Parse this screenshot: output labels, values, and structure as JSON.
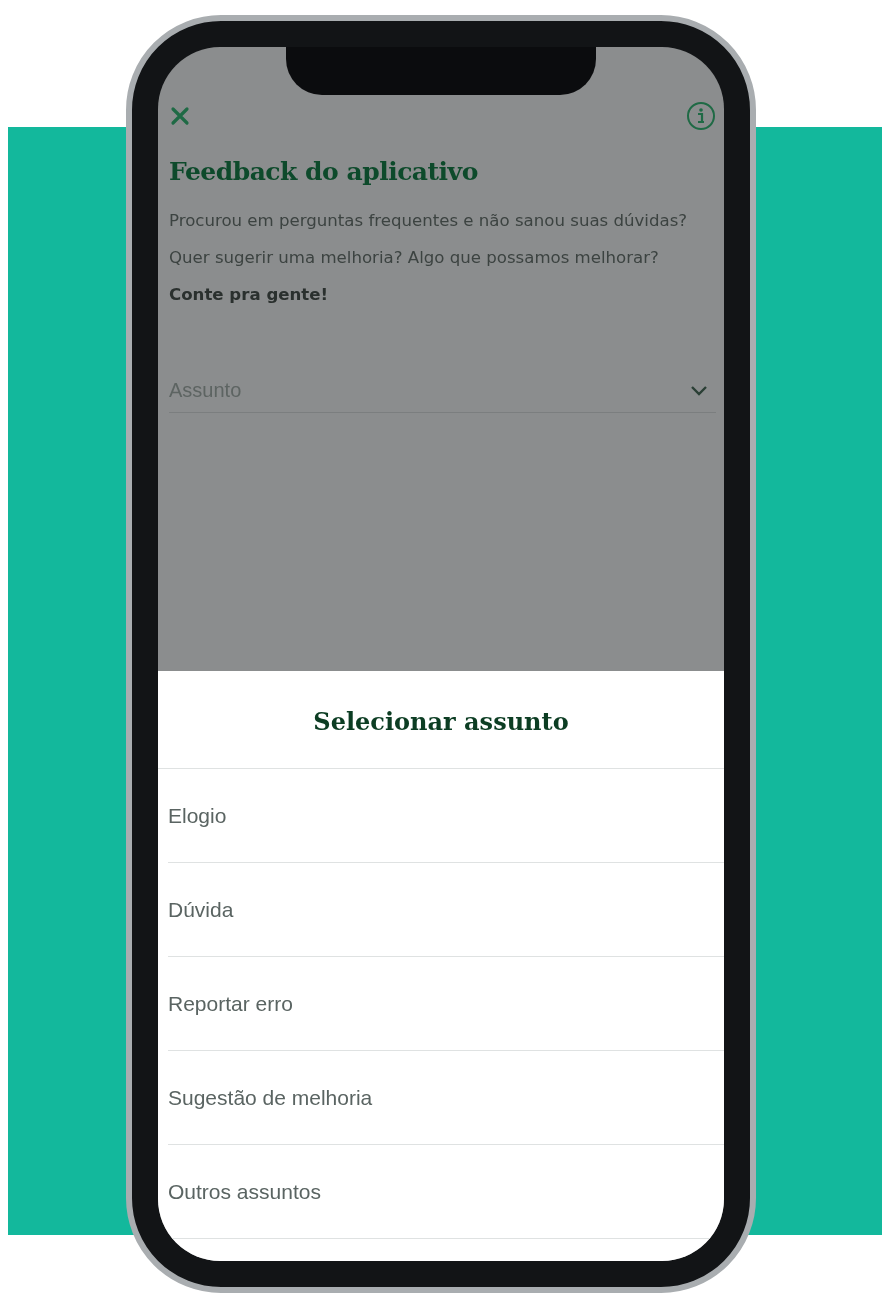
{
  "screen": {
    "title": "Feedback do aplicativo",
    "description": "Procurou em perguntas frequentes e não sanou suas dúvidas? Quer sugerir uma melhoria? Algo que possamos melhorar? **Conte pra gente!**",
    "field": {
      "placeholder": "Assunto"
    }
  },
  "sheet": {
    "title": "Selecionar assunto",
    "options": [
      {
        "label": "Elogio"
      },
      {
        "label": "Dúvida"
      },
      {
        "label": "Reportar erro"
      },
      {
        "label": "Sugestão de melhoria"
      },
      {
        "label": "Outros assuntos"
      }
    ]
  }
}
